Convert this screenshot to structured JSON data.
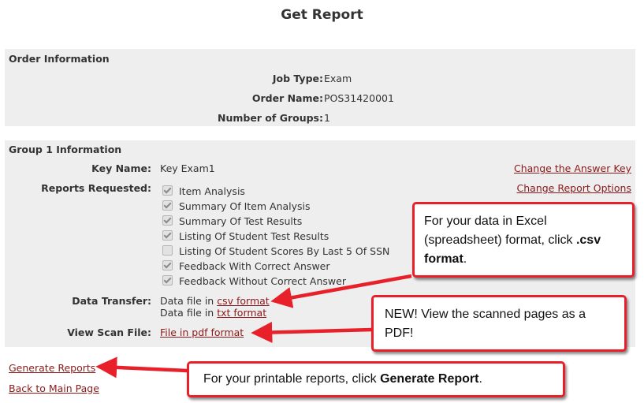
{
  "page": {
    "title": "Get Report"
  },
  "order": {
    "header": "Order Information",
    "rows": [
      {
        "label": "Job Type:",
        "value": "Exam"
      },
      {
        "label": "Order Name:",
        "value": "POS31420001"
      },
      {
        "label": "Number of Groups:",
        "value": "1"
      }
    ]
  },
  "group": {
    "header": "Group 1 Information",
    "key_label": "Key Name:",
    "key_value": "Key Exam1",
    "change_key_link": "Change the Answer Key",
    "reports_label": "Reports Requested:",
    "change_options_link": "Change Report Options",
    "reports": [
      {
        "label": "Item Analysis",
        "checked": true
      },
      {
        "label": "Summary Of Item Analysis",
        "checked": true
      },
      {
        "label": "Summary Of Test Results",
        "checked": true
      },
      {
        "label": "Listing Of Student Test Results",
        "checked": true
      },
      {
        "label": "Listing Of Student Scores By Last 5 Of SSN",
        "checked": false
      },
      {
        "label": "Feedback With Correct Answer",
        "checked": true
      },
      {
        "label": "Feedback Without Correct Answer",
        "checked": true
      }
    ],
    "data_transfer_label": "Data Transfer:",
    "data_file_prefix": "Data file in",
    "csv_link": "csv format",
    "txt_link": "txt format",
    "scan_label": "View Scan File:",
    "pdf_link": "File in pdf format"
  },
  "links": {
    "generate": "Generate Reports",
    "back": "Back to Main Page"
  },
  "callouts": {
    "csv": {
      "pre": "For your data in Excel (spreadsheet) format, click ",
      "bold": ".csv format",
      "post": "."
    },
    "pdf": {
      "text": "NEW! View the scanned pages as a PDF!"
    },
    "generate": {
      "pre": "For your printable reports, click ",
      "bold": "Generate Report",
      "post": "."
    }
  },
  "colors": {
    "link": "#8b1a1a",
    "panel": "#eeeeee",
    "callout_border": "#e8202a",
    "arrow": "#e8202a"
  }
}
